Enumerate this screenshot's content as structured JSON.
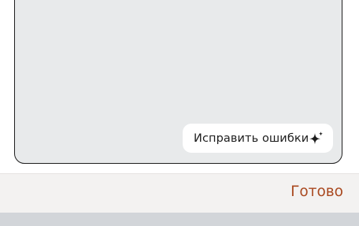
{
  "editor": {
    "fix_button": {
      "label": "Исправить ошибки",
      "icon": "sparkle-icon"
    }
  },
  "toolbar": {
    "done_label": "Готово"
  },
  "colors": {
    "editor_background": "#e8eaeb",
    "done_accent": "#a9481f",
    "keyboard_background": "#d2d5d9"
  }
}
